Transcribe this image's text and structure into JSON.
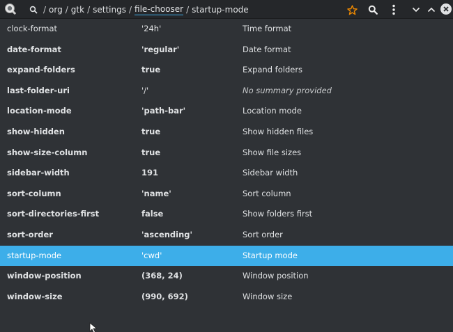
{
  "header": {
    "path": [
      "org",
      "gtk",
      "settings",
      "file-chooser",
      "startup-mode"
    ],
    "separator": "/",
    "buttons": [
      "bookmark-star-icon",
      "search-icon",
      "menu-icon",
      "chevron-down-icon",
      "chevron-up-icon",
      "close-icon"
    ],
    "accent_color": "#3daee9",
    "star_color": "#f08a00"
  },
  "keys": [
    {
      "name": "clock-format",
      "value": "'24h'",
      "summary": "Time format"
    },
    {
      "name": "date-format",
      "value": "'regular'",
      "summary": "Date format"
    },
    {
      "name": "expand-folders",
      "value": "true",
      "summary": "Expand folders"
    },
    {
      "name": "last-folder-uri",
      "value": "'/'",
      "summary": "No summary provided"
    },
    {
      "name": "location-mode",
      "value": "'path-bar'",
      "summary": "Location mode"
    },
    {
      "name": "show-hidden",
      "value": "true",
      "summary": "Show hidden files"
    },
    {
      "name": "show-size-column",
      "value": "true",
      "summary": "Show file sizes"
    },
    {
      "name": "sidebar-width",
      "value": "191",
      "summary": "Sidebar width"
    },
    {
      "name": "sort-column",
      "value": "'name'",
      "summary": "Sort column"
    },
    {
      "name": "sort-directories-first",
      "value": "false",
      "summary": "Show folders first"
    },
    {
      "name": "sort-order",
      "value": "'ascending'",
      "summary": "Sort order"
    },
    {
      "name": "startup-mode",
      "value": "'cwd'",
      "summary": "Startup mode"
    },
    {
      "name": "window-position",
      "value": "(368, 24)",
      "summary": "Window position"
    },
    {
      "name": "window-size",
      "value": "(990, 692)",
      "summary": "Window size"
    }
  ],
  "selected_key": "startup-mode",
  "colors": {
    "background": "#2f3236",
    "headerbar": "#25272a",
    "selection": "#3daee9",
    "text": "#dfe1e3"
  }
}
